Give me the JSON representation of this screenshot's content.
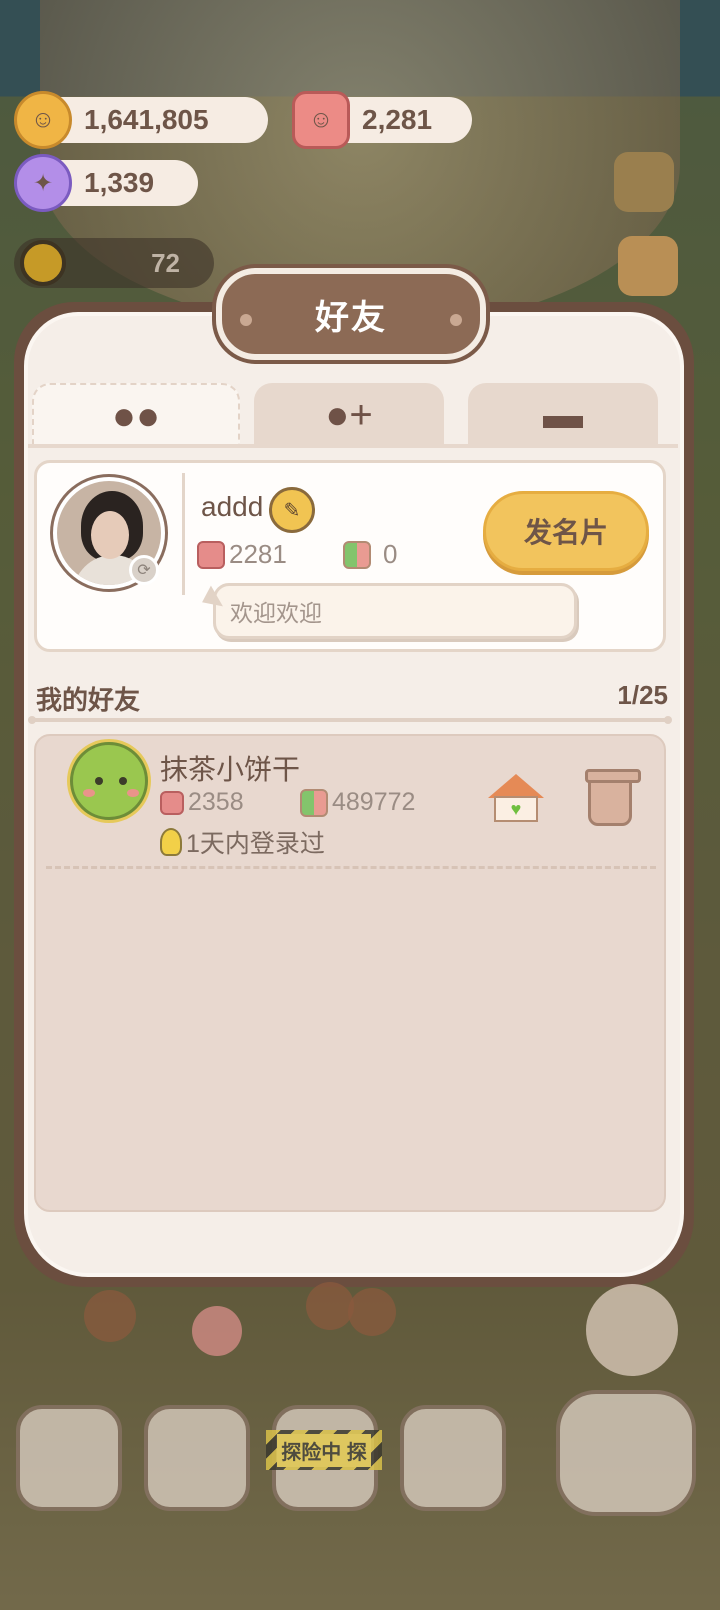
{
  "resources": [
    {
      "icon": "cookie-icon",
      "value": "1,641,805"
    },
    {
      "icon": "gummy-icon",
      "value": "2,281"
    },
    {
      "icon": "candy-icon",
      "value": "1,339"
    }
  ],
  "level": {
    "value": "72"
  },
  "dialog": {
    "title": "好友"
  },
  "tabs": [
    {
      "icon": "friends-icon"
    },
    {
      "icon": "add-friend-icon"
    },
    {
      "icon": "briefcase-icon"
    }
  ],
  "profile": {
    "name": "addd",
    "gummies": "2281",
    "gifts": "0",
    "send_card_label": "发名片",
    "message": "欢迎欢迎"
  },
  "friends_section": {
    "title": "我的好友",
    "count": "1/25"
  },
  "friends": [
    {
      "name": "抹茶小饼干",
      "gummies": "2358",
      "gifts": "489772",
      "login": "1天内登录过"
    }
  ],
  "bottom_nav": {
    "adventure_label": "探险中 探"
  }
}
